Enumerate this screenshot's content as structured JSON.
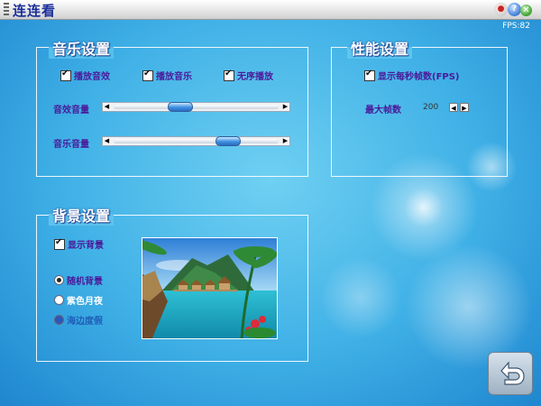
{
  "window": {
    "title": "连连看",
    "fps_text": "FPS:82",
    "buttons": [
      "minimize-icon",
      "help-icon",
      "close-icon"
    ]
  },
  "music_settings": {
    "title": "音乐设置",
    "play_sfx": {
      "label": "播放音效",
      "checked": true
    },
    "play_music": {
      "label": "播放音乐",
      "checked": true
    },
    "shuffle": {
      "label": "无序播放",
      "checked": true
    },
    "sfx_volume": {
      "label": "音效音量",
      "value": 0.39
    },
    "music_volume": {
      "label": "音乐音量",
      "value": 0.73
    }
  },
  "performance_settings": {
    "title": "性能设置",
    "show_fps": {
      "label": "显示每秒帧数(FPS)",
      "checked": true
    },
    "max_fps": {
      "label": "最大帧数",
      "value": "200"
    }
  },
  "background_settings": {
    "title": "背景设置",
    "show_bg": {
      "label": "显示背景",
      "checked": true
    },
    "options": [
      {
        "label": "随机背景",
        "selected": true
      },
      {
        "label": "紫色月夜",
        "selected": false
      },
      {
        "label": "海边度假",
        "selected": false
      }
    ]
  },
  "colors": {
    "label_text": "#4a1a9a",
    "title_text": "#1b2f9c",
    "background": "#3fb0e6"
  },
  "icons": {
    "back": "back-arrow-icon"
  }
}
